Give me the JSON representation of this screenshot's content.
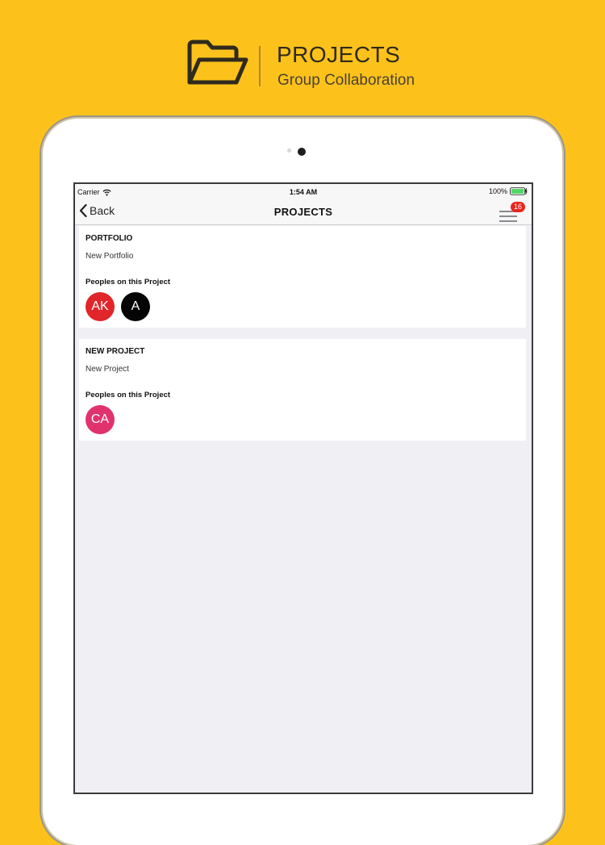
{
  "header": {
    "title": "PROJECTS",
    "subtitle": "Group Collaboration",
    "icon": "folder-open-icon"
  },
  "status_bar": {
    "carrier": "Carrier",
    "time": "1:54 AM",
    "battery": "100%"
  },
  "nav": {
    "back_label": "Back",
    "title": "PROJECTS",
    "badge": "16"
  },
  "projects": [
    {
      "title": "PORTFOLIO",
      "subtitle": "New Portfolio",
      "people_label": "Peoples on this Project",
      "members": [
        {
          "initials": "AK",
          "color": "#e0262a"
        },
        {
          "initials": "A",
          "color": "#050505"
        }
      ]
    },
    {
      "title": "NEW PROJECT",
      "subtitle": "New Project",
      "people_label": "Peoples on this Project",
      "members": [
        {
          "initials": "CA",
          "color": "#e0336e"
        }
      ]
    }
  ],
  "colors": {
    "background": "#FCC21B",
    "badge": "#e8261f",
    "battery": "#4cd964"
  }
}
